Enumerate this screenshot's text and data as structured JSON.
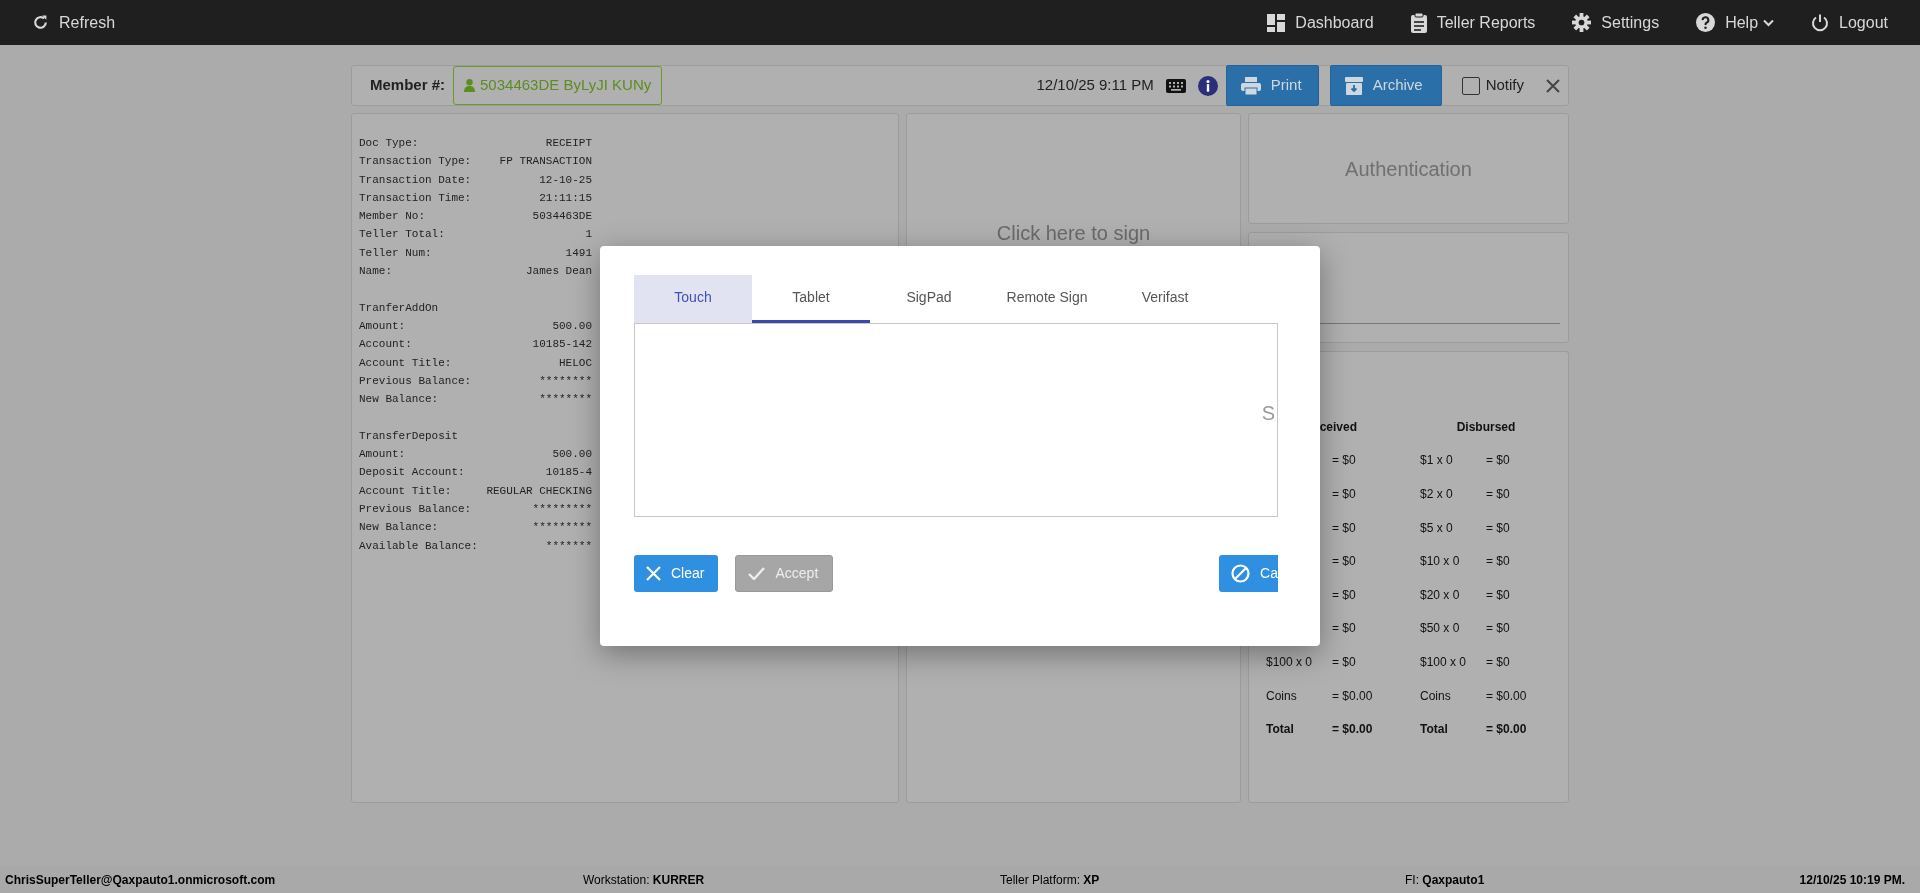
{
  "navbar": {
    "left": [
      {
        "label": "Refresh",
        "kind": "refresh",
        "dropdown": false
      }
    ],
    "right": [
      {
        "label": "Dashboard",
        "kind": "dashboard",
        "dropdown": false
      },
      {
        "label": "Teller Reports",
        "kind": "reports",
        "dropdown": false
      },
      {
        "label": "Settings",
        "kind": "settings",
        "dropdown": false
      },
      {
        "label": "Help",
        "kind": "help",
        "dropdown": true
      },
      {
        "label": "Logout",
        "kind": "logout",
        "dropdown": false
      }
    ]
  },
  "member_bar": {
    "label": "Member #:",
    "member": "5034463DE ByLyJI KUNy",
    "datetime": "12/10/25 9:11 PM",
    "buttons": [
      {
        "label": "Print",
        "kind": "print"
      },
      {
        "label": "Archive",
        "kind": "archive"
      }
    ],
    "notify": {
      "label": "Notify",
      "checked": false
    }
  },
  "receipt": {
    "sections": [
      {
        "lines": [
          {
            "label": "Doc Type:",
            "value": "RECEIPT"
          },
          {
            "label": "Transaction Type:",
            "value": "FP TRANSACTION"
          },
          {
            "label": "Transaction Date:",
            "value": "12-10-25"
          },
          {
            "label": "Transaction Time:",
            "value": "21:11:15"
          },
          {
            "label": "Member No:",
            "value": "5034463DE"
          },
          {
            "label": "Teller Total:",
            "value": "1"
          },
          {
            "label": "Teller Num:",
            "value": "1491"
          },
          {
            "label": "Name:",
            "value": "James Dean"
          }
        ]
      },
      {
        "heading": "TranferAddOn",
        "lines": [
          {
            "label": "Amount:",
            "value": "500.00"
          },
          {
            "label": "Account:",
            "value": "10185-142"
          },
          {
            "label": "Account Title:",
            "value": "HELOC"
          },
          {
            "label": "Previous Balance:",
            "value": "********"
          },
          {
            "label": "New Balance:",
            "value": "********"
          }
        ]
      },
      {
        "heading": "TransferDeposit",
        "lines": [
          {
            "label": "Amount:",
            "value": "500.00"
          },
          {
            "label": "Deposit Account:",
            "value": "10185-4"
          },
          {
            "label": "Account Title:",
            "value": "REGULAR CHECKING"
          },
          {
            "label": "Previous Balance:",
            "value": "*********"
          },
          {
            "label": "New Balance:",
            "value": "*********"
          },
          {
            "label": "Available Balance:",
            "value": "*******"
          }
        ]
      }
    ]
  },
  "signature_panel": {
    "prompt": "Click here to sign"
  },
  "authentication": {
    "title": "Authentication"
  },
  "cash": {
    "columns": [
      {
        "header": "ceived",
        "rows": [
          {
            "value": "= $0",
            "kind": "normal"
          },
          {
            "value": "= $0",
            "kind": "normal"
          },
          {
            "value": "= $0",
            "kind": "normal"
          },
          {
            "value": "= $0",
            "kind": "normal"
          },
          {
            "value": "= $0",
            "kind": "normal"
          },
          {
            "value": "= $0",
            "kind": "normal"
          },
          {
            "label": "$100 x 0",
            "value": "= $0",
            "kind": "normal"
          },
          {
            "label": "Coins",
            "value": "= $0.00",
            "kind": "normal"
          },
          {
            "label": "Total",
            "value": "= $0.00",
            "kind": "total"
          }
        ]
      },
      {
        "header": "Disbursed",
        "rows": [
          {
            "label": "$1 x 0",
            "value": "= $0",
            "kind": "normal"
          },
          {
            "label": "$2 x 0",
            "value": "= $0",
            "kind": "normal"
          },
          {
            "label": "$5 x 0",
            "value": "= $0",
            "kind": "normal"
          },
          {
            "label": "$10 x 0",
            "value": "= $0",
            "kind": "normal"
          },
          {
            "label": "$20 x 0",
            "value": "= $0",
            "kind": "normal"
          },
          {
            "label": "$50 x 0",
            "value": "= $0",
            "kind": "normal"
          },
          {
            "label": "$100 x 0",
            "value": "= $0",
            "kind": "normal"
          },
          {
            "label": "Coins",
            "value": "= $0.00",
            "kind": "normal"
          },
          {
            "label": "Total",
            "value": "= $0.00",
            "kind": "total"
          }
        ]
      }
    ]
  },
  "modal": {
    "tabs": [
      {
        "label": "Touch",
        "hovered": true,
        "selected": false
      },
      {
        "label": "Tablet",
        "hovered": false,
        "selected": true
      },
      {
        "label": "SigPad",
        "hovered": false,
        "selected": false
      },
      {
        "label": "Remote Sign",
        "hovered": false,
        "selected": false
      },
      {
        "label": "Verifast",
        "hovered": false,
        "selected": false
      }
    ],
    "pad_text": "S",
    "buttons": [
      {
        "label": "Clear",
        "kind": "clear",
        "disabled": false
      },
      {
        "label": "Accept",
        "kind": "accept",
        "disabled": true
      },
      {
        "label": "Ca",
        "kind": "cancel",
        "disabled": false
      }
    ]
  },
  "status_bar": {
    "user": "ChrisSuperTeller@Qaxpauto1.onmicrosoft.com",
    "items": [
      "Workstation: **KURRER**",
      "Teller Platform: **XP**",
      "FI: **Qaxpauto1**"
    ],
    "datetime": "12/10/25 10:19 PM."
  }
}
